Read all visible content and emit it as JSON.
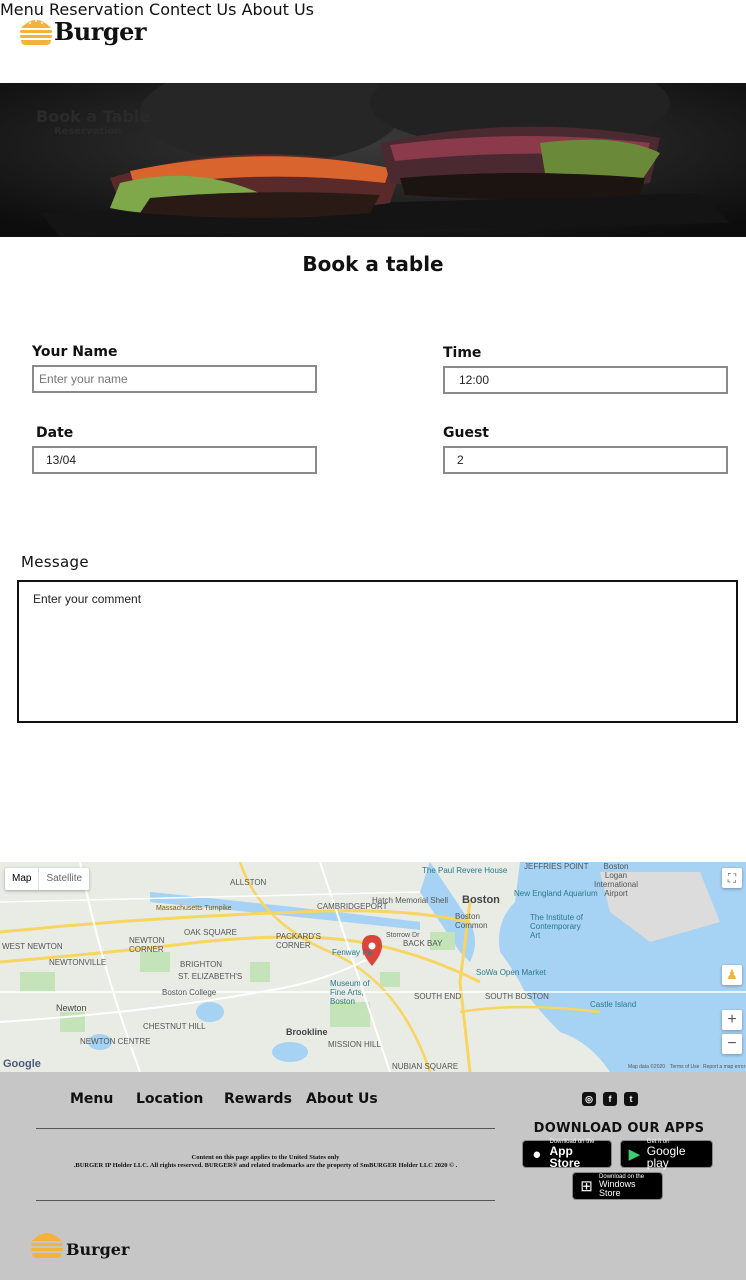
{
  "header": {
    "logo_text": "Burger",
    "nav": [
      {
        "label": "Menu"
      },
      {
        "label": "Reservation"
      },
      {
        "label": "Contect Us"
      },
      {
        "label": "About Us"
      }
    ]
  },
  "hero": {
    "title": "Book a Table",
    "subtitle": "Reservation"
  },
  "form": {
    "title": "Book a table",
    "name_label": "Your Name",
    "name_placeholder": "Enter your name",
    "time_label": "Time",
    "time_value": "12:00",
    "date_label": "Date",
    "date_value": "13/04",
    "guest_label": "Guest",
    "guest_value": "2",
    "message_label": "Message",
    "message_placeholder": "Enter your comment"
  },
  "map": {
    "map_tab": "Map",
    "satellite_tab": "Satellite",
    "google": "Google",
    "labels": {
      "boston": "Boston",
      "newton": "Newton",
      "brookline": "Brookline",
      "hatch": "Hatch Memorial Shell",
      "aquarium": "New England Aquarium",
      "ica": "The Institute of Contemporary Art",
      "mfa": "Museum of Fine Arts, Boston",
      "bc": "Boston College",
      "castle": "Castle Island",
      "airport": "Boston Logan International Airport",
      "revere": "The Paul Revere House",
      "common": "Boston Common",
      "sowa": "SoWa Open Market",
      "south_end": "SOUTH END",
      "south_boston": "SOUTH BOSTON",
      "back_bay": "BACK BAY",
      "brighton": "BRIGHTON",
      "allston": "ALLSTON",
      "fenway": "Fenway Pa",
      "newtonville": "NEWTONVILLE",
      "west_newton": "WEST NEWTON",
      "newton_corner": "NEWTON CORNER",
      "oak_square": "OAK SQUARE",
      "st_elizabeth": "ST. ELIZABETH'S",
      "chestnut_hill": "CHESTNUT HILL",
      "newton_centre": "NEWTON CENTRE",
      "mission_hill": "MISSION HILL",
      "packards": "PACKARD'S CORNER",
      "cambridgeport": "CAMBRIDGEPORT",
      "jeffries": "JEFFRIES POINT",
      "dudley": "NUBIAN SQUARE",
      "mass_pike": "Massachusetts Turnpike",
      "storrow": "Storrow Dr",
      "map_data": "Map data ©2020",
      "terms": "Terms of Use",
      "report": "Report a map error"
    }
  },
  "footer": {
    "links": [
      {
        "label": "Menu"
      },
      {
        "label": "Location"
      },
      {
        "label": "Rewards"
      },
      {
        "label": "About Us"
      }
    ],
    "note_line1": "Content on this page applies to the United States only",
    "note_line2": ".BURGER IP Holder LLC. All rights reserved. BURGER® and related trademarks are the property of SmBURGER  Holder LLC 2020 © .",
    "apps_title": "DOWNLOAD OUR APPS",
    "app_store_small": "Download on the",
    "app_store_big": "App Store",
    "google_play_small": "Get it on",
    "google_play_big": "Google play",
    "windows_small": "Download on the",
    "windows_big": "Windows Store",
    "logo_text": "Burger",
    "social": [
      "instagram-icon",
      "facebook-icon",
      "twitter-icon"
    ]
  },
  "colors": {
    "accent": "#f2b33d",
    "footer_bg": "#c6c6c6",
    "pin": "#d9453b"
  }
}
